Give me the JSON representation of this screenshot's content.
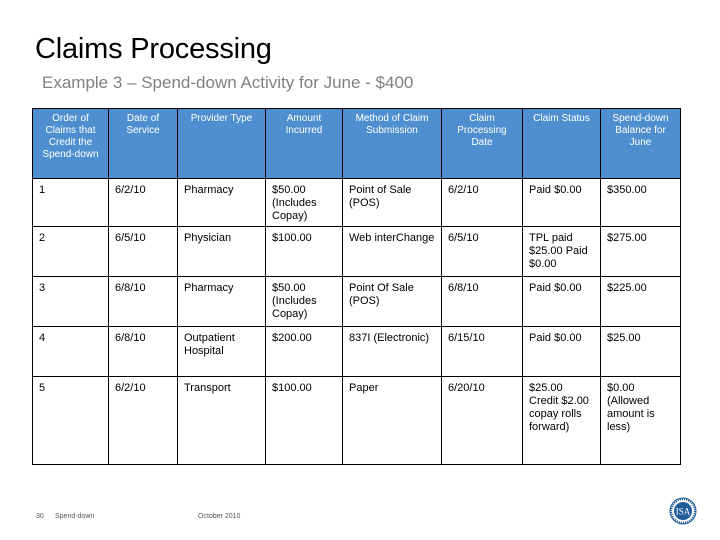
{
  "header": {
    "title": "Claims Processing",
    "subtitle": "Example 3 – Spend-down Activity for June - $400"
  },
  "table": {
    "header_color": "#4f8fcf",
    "columns": [
      "Order of Claims that Credit the Spend-down",
      "Date of Service",
      "Provider Type",
      "Amount Incurred",
      "Method of Claim Submission",
      "Claim Processing Date",
      "Claim Status",
      "Spend-down Balance for June"
    ],
    "rows": [
      {
        "order": "1",
        "date_of_service": "6/2/10",
        "provider_type": "Pharmacy",
        "amount_incurred": "$50.00 (Includes Copay)",
        "method": "Point of Sale (POS)",
        "processing_date": "6/2/10",
        "status": "Paid $0.00",
        "balance": "$350.00"
      },
      {
        "order": "2",
        "date_of_service": "6/5/10",
        "provider_type": "Physician",
        "amount_incurred": "$100.00",
        "method": "Web interChange",
        "processing_date": "6/5/10",
        "status": "TPL paid $25.00 Paid $0.00",
        "balance": "$275.00"
      },
      {
        "order": "3",
        "date_of_service": "6/8/10",
        "provider_type": "Pharmacy",
        "amount_incurred": "$50.00 (Includes Copay)",
        "method": "Point Of  Sale (POS)",
        "processing_date": "6/8/10",
        "status": "Paid $0.00",
        "balance": "$225.00"
      },
      {
        "order": "4",
        "date_of_service": "6/8/10",
        "provider_type": "Outpatient Hospital",
        "amount_incurred": "$200.00",
        "method": "837I (Electronic)",
        "processing_date": "6/15/10",
        "status": "Paid $0.00",
        "balance": "$25.00"
      },
      {
        "order": "5",
        "date_of_service": "6/2/10",
        "provider_type": "Transport",
        "amount_incurred": "$100.00",
        "method": "Paper",
        "processing_date": "6/20/10",
        "status": "$25.00 Credit $2.00 copay rolls forward)",
        "balance": "$0.00 (Allowed amount is less)"
      }
    ]
  },
  "footer": {
    "page_number": "30",
    "topic": "Spend-down",
    "date": "October 2010"
  },
  "logo": {
    "icon": "seal-logo-icon",
    "text": "ISA",
    "color": "#1f5c99"
  }
}
